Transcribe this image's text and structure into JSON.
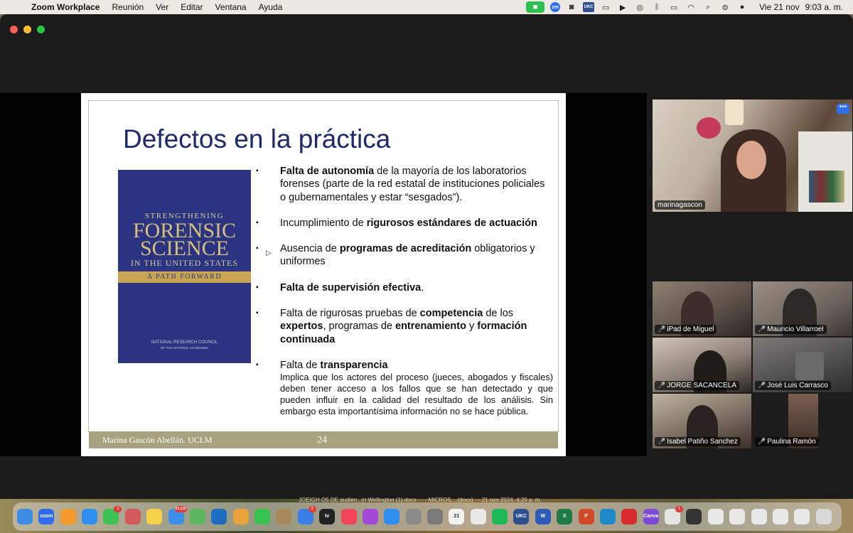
{
  "menubar": {
    "apple": "",
    "app_name": "Zoom Workplace",
    "menus": [
      "Reunión",
      "Ver",
      "Editar",
      "Ventana",
      "Ayuda"
    ],
    "status_icons": [
      "zoom-video-icon",
      "zoom-menu-icon",
      "camera-capture-icon",
      "ukc-icon",
      "screen-mirror-icon",
      "play-icon",
      "airdrop-icon",
      "bluetooth-icon",
      "battery-icon",
      "wifi-icon",
      "spotlight-icon",
      "control-center-icon",
      "siri-icon"
    ],
    "zoom_label": "zm",
    "ukc_label": "UKC",
    "date": "Vie 21 nov",
    "time": "9:03 a. m."
  },
  "slide": {
    "title": "Defectos en la práctica",
    "book": {
      "line1": "STRENGTHENING",
      "line2": "FORENSIC",
      "line3": "SCIENCE",
      "line4": "IN THE UNITED STATES",
      "band": "A PATH FORWARD",
      "publisher": "NATIONAL RESEARCH COUNCIL",
      "publisher_sub": "OF THE NATIONAL ACADEMIES"
    },
    "bullet_symbol": "▪",
    "bullets": [
      {
        "bold": "Falta de autonomía",
        "rest": " de la mayoría de los laboratorios forenses (parte de la red estatal de instituciones policiales o gubernamentales y estar “sesgados”)."
      },
      {
        "pre": "Incumplimiento de ",
        "bold": "rigurosos estándares de actuación"
      },
      {
        "pre": "Ausencia de ",
        "bold": "programas de acreditación",
        "rest": " obligatorios y uniformes"
      },
      {
        "bold": "Falta de supervisión efectiva",
        "rest": "."
      },
      {
        "pre": "Falta de rigurosas pruebas de ",
        "bold": "competencia",
        "mid": " de los ",
        "bold2": "expertos",
        "mid2": ", programas de ",
        "bold3": "entrenamiento",
        "mid3": " y ",
        "bold4": "formación continuada"
      },
      {
        "pre": "Falta de ",
        "bold": "transparencia",
        "sub": "Implica que los actores del proceso (jueces, abogados y fiscales) deben tener acceso a los fallos que se han detectado y que pueden influir en la calidad del resultado de los análisis. Sin embargo esta importantísima información no se hace pública."
      }
    ],
    "footer_author": "Marina Gascón Abellán. UCLM",
    "page_number": "24"
  },
  "participants": {
    "speaker": "marinagascon",
    "more_label": "•••",
    "gallery": [
      "iPad de Miguel",
      "Mauricio Villarroel",
      "JORGE SACANCELA",
      "José Luis Carrasco",
      "Isabel Patiño Sanchez",
      "Paulina Ramón"
    ],
    "muted_icon": "🎤"
  },
  "dock": {
    "strip_text": "JOEIGH O5 DE audien...in Wellington (1).docx  ·  ·  ·  MICROS....(docx)  ·  ·  21 nov 2024, 4:20 p. m.",
    "apps": [
      {
        "name": "finder",
        "color": "#3b8de6",
        "label": ""
      },
      {
        "name": "zoom",
        "color": "#2d6cf0",
        "label": "zoom"
      },
      {
        "name": "pages",
        "color": "#f29a2b",
        "label": ""
      },
      {
        "name": "safari",
        "color": "#2f8ff0",
        "label": ""
      },
      {
        "name": "messages",
        "color": "#3ec250",
        "label": "",
        "badge": "1"
      },
      {
        "name": "launchpad",
        "color": "#d25a5a",
        "label": ""
      },
      {
        "name": "notes",
        "color": "#f4d24a",
        "label": ""
      },
      {
        "name": "mail",
        "color": "#3a8fe8",
        "label": "",
        "badge": "23.116"
      },
      {
        "name": "maps",
        "color": "#5bb85c",
        "label": ""
      },
      {
        "name": "outlook",
        "color": "#1b6ec2",
        "label": ""
      },
      {
        "name": "photos",
        "color": "#e8a23a",
        "label": ""
      },
      {
        "name": "facetime",
        "color": "#37c34e",
        "label": ""
      },
      {
        "name": "archive",
        "color": "#a88a5a",
        "label": ""
      },
      {
        "name": "app-store",
        "color": "#3a7fe6",
        "label": "",
        "badge": "2"
      },
      {
        "name": "tv",
        "color": "#222222",
        "label": "tv"
      },
      {
        "name": "music",
        "color": "#f2455a",
        "label": ""
      },
      {
        "name": "podcasts",
        "color": "#a248d6",
        "label": ""
      },
      {
        "name": "keynote",
        "color": "#2f8ff0",
        "label": ""
      },
      {
        "name": "settings",
        "color": "#8a8a8a",
        "label": ""
      },
      {
        "name": "activity",
        "color": "#7a7a7a",
        "label": ""
      },
      {
        "name": "calendar",
        "color": "#f2f2f2",
        "label": "21"
      },
      {
        "name": "chrome",
        "color": "#e9e9e9",
        "label": ""
      },
      {
        "name": "spotify",
        "color": "#1db954",
        "label": ""
      },
      {
        "name": "ukc",
        "color": "#2d4f8f",
        "label": "UKC"
      },
      {
        "name": "word",
        "color": "#2b5cb8",
        "label": "W"
      },
      {
        "name": "excel",
        "color": "#1f7a45",
        "label": "X"
      },
      {
        "name": "powerpoint",
        "color": "#d2492a",
        "label": "P"
      },
      {
        "name": "edge",
        "color": "#1e88c9",
        "label": ""
      },
      {
        "name": "acrobat",
        "color": "#d92b2b",
        "label": ""
      },
      {
        "name": "canva",
        "color": "#7b4bd8",
        "label": "Canva"
      },
      {
        "name": "preview",
        "color": "#e5e5e5",
        "label": "",
        "badge": "1"
      },
      {
        "name": "window-1",
        "color": "#333333",
        "label": ""
      },
      {
        "name": "window-2",
        "color": "#e8e8e8",
        "label": ""
      },
      {
        "name": "window-3",
        "color": "#e8e8e8",
        "label": ""
      },
      {
        "name": "window-4",
        "color": "#e8e8e8",
        "label": ""
      },
      {
        "name": "window-5",
        "color": "#e8e8e8",
        "label": ""
      },
      {
        "name": "window-6",
        "color": "#e8e8e8",
        "label": ""
      },
      {
        "name": "trash",
        "color": "#d8d8d8",
        "label": ""
      }
    ]
  }
}
